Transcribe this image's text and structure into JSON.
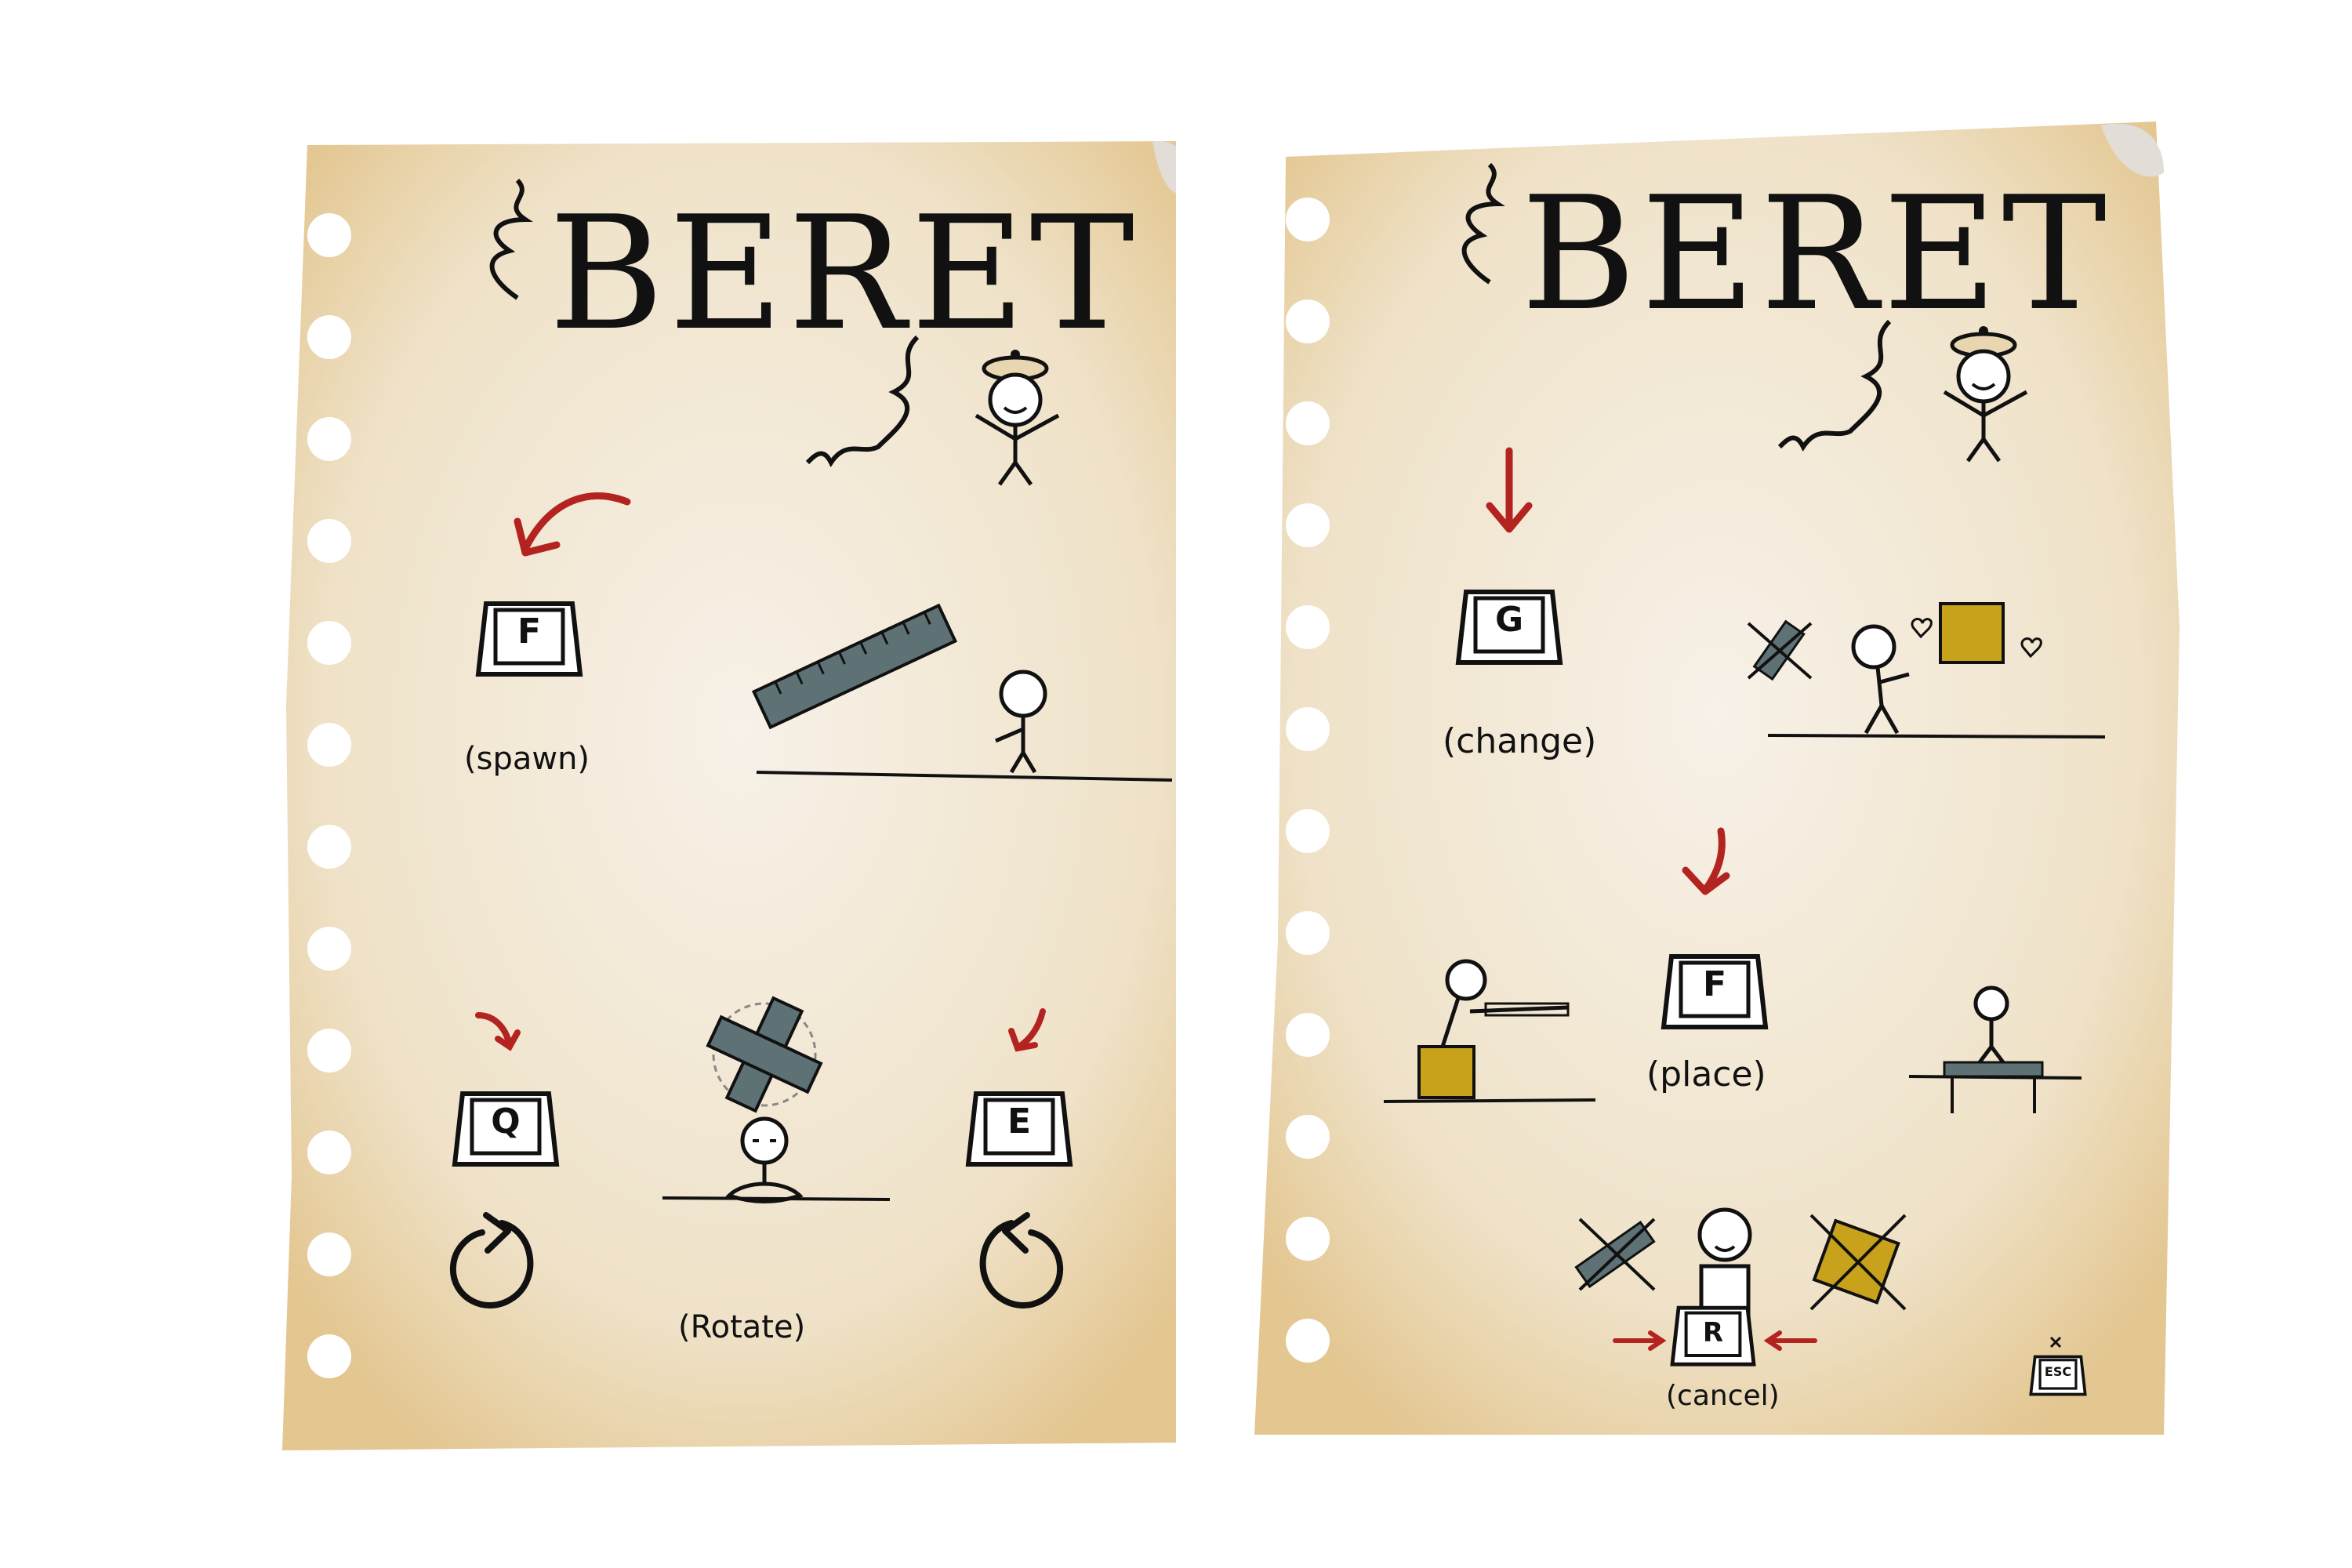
{
  "pages": [
    {
      "title": "BERET",
      "spawn": {
        "key": "F",
        "label": "(spawn)"
      },
      "rotate": {
        "key_left": "Q",
        "key_right": "E",
        "label": "(Rotate)"
      }
    },
    {
      "title": "BERET",
      "change": {
        "key": "G",
        "label": "(change)"
      },
      "place": {
        "key": "F",
        "label": "(place)"
      },
      "cancel": {
        "key": "R",
        "label": "(cancel)"
      },
      "exit": {
        "key": "ESC"
      }
    }
  ],
  "colors": {
    "paper": "#f4ece0",
    "paper_edge": "#e8cfa0",
    "ink": "#111111",
    "arrow_red": "#b3231f",
    "ruler": "#5e7275",
    "crate": "#c9a21b"
  }
}
